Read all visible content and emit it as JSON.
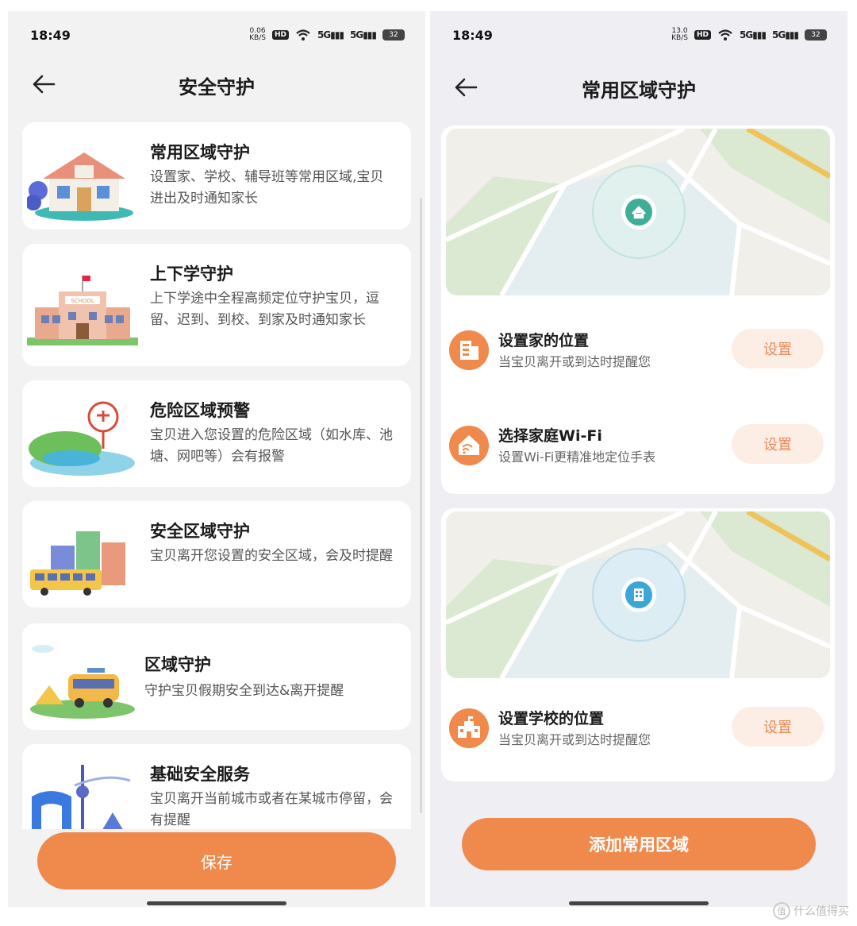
{
  "left": {
    "status": {
      "time": "18:49",
      "speed": "0.06",
      "speed_unit": "KB/S",
      "hd": "HD",
      "net1": "5G",
      "net2": "5G",
      "battery": "32"
    },
    "title": "安全守护",
    "cards": [
      {
        "title": "常用区域守护",
        "desc": "设置家、学校、辅导班等常用区域,宝贝进出及时通知家长",
        "icon": "house-illustration"
      },
      {
        "title": "上下学守护",
        "desc": "上下学途中全程高频定位守护宝贝，逗留、迟到、到校、到家及时通知家长",
        "icon": "school-illustration",
        "sign": "SCHOOL"
      },
      {
        "title": "危险区域预警",
        "desc": "宝贝进入您设置的危险区域（如水库、池塘、网吧等）会有报警",
        "icon": "danger-lake-illustration"
      },
      {
        "title": "安全区域守护",
        "desc": "宝贝离开您设置的安全区域，会及时提醒",
        "icon": "city-bus-illustration"
      },
      {
        "title": "区域守护",
        "desc": "守护宝贝假期安全到达&离开提醒",
        "icon": "camping-van-illustration"
      },
      {
        "title": "基础安全服务",
        "desc": "宝贝离开当前城市或者在某城市停留，会有提醒",
        "icon": "city-landmark-illustration"
      }
    ],
    "save_label": "保存"
  },
  "right": {
    "status": {
      "time": "18:49",
      "speed": "13.0",
      "speed_unit": "KB/S",
      "hd": "HD",
      "net1": "5G",
      "net2": "5G",
      "battery": "32"
    },
    "title": "常用区域守护",
    "home_card": {
      "rows": [
        {
          "title": "设置家的位置",
          "desc": "当宝贝离开或到达时提醒您",
          "button": "设置",
          "icon": "building-icon"
        },
        {
          "title": "选择家庭Wi-Fi",
          "desc": "设置Wi-Fi更精准地定位手表",
          "button": "设置",
          "icon": "home-wifi-icon"
        }
      ]
    },
    "school_card": {
      "rows": [
        {
          "title": "设置学校的位置",
          "desc": "当宝贝离开或到达时提醒您",
          "button": "设置",
          "icon": "school-icon"
        }
      ]
    },
    "add_label": "添加常用区域"
  },
  "watermark": "什么值得买",
  "watermark_logo": "值",
  "colors": {
    "accent": "#ef8a4c",
    "accent_light": "#fdeee5",
    "map_pin_green": "#3fae97",
    "map_pin_blue": "#3aa7d6"
  }
}
